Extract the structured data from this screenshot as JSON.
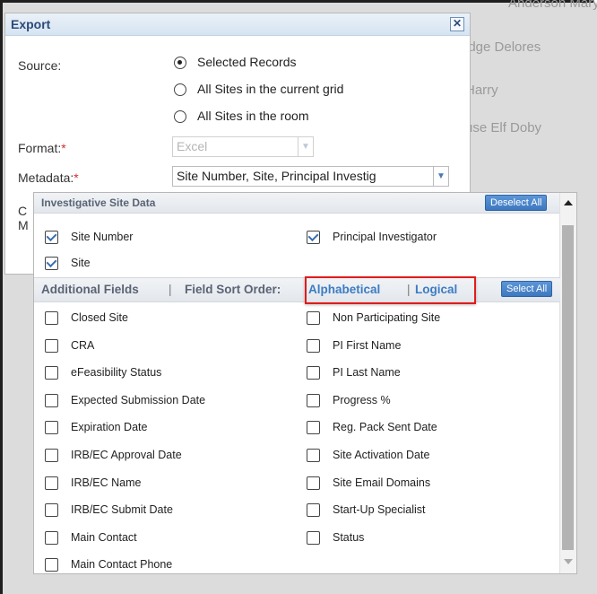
{
  "background_grid": [
    {
      "text": "Anderson Mary"
    },
    {
      "text": "idge Delores"
    },
    {
      "text": "Harry"
    },
    {
      "text": "use Elf Doby"
    }
  ],
  "dialog": {
    "title": "Export",
    "close_label": "✕",
    "source_label": "Source:",
    "source_options": [
      {
        "label": "Selected Records",
        "selected": true
      },
      {
        "label": "All Sites in the current grid",
        "selected": false
      },
      {
        "label": "All Sites in the room",
        "selected": false
      }
    ],
    "format_label": "Format:",
    "format_value": "Excel",
    "metadata_label": "Metadata:",
    "metadata_value": "Site Number, Site, Principal Investig",
    "required_marker": "*",
    "partial_label_1": "C",
    "partial_label_2": "M"
  },
  "field_panel": {
    "section_title": "Investigative Site Data",
    "deselect_all": "Deselect All",
    "select_all": "Select All",
    "selected_fields": [
      {
        "label": "Site Number",
        "checked": true
      },
      {
        "label": "Principal Investigator",
        "checked": true
      },
      {
        "label": "Site",
        "checked": true
      }
    ],
    "additional_fields_label": "Additional Fields",
    "pipe": "|",
    "sort_order_label": "Field Sort Order:",
    "sort_alphabetical": "Alphabetical",
    "sort_logical": "Logical",
    "additional_left": [
      "Closed Site",
      "CRA",
      "eFeasibility Status",
      "Expected Submission Date",
      "Expiration Date",
      "IRB/EC Approval Date",
      "IRB/EC Name",
      "IRB/EC Submit Date",
      "Main Contact",
      "Main Contact Phone"
    ],
    "additional_right": [
      "Non Participating Site",
      "PI First Name",
      "PI Last Name",
      "Progress %",
      "Reg. Pack Sent Date",
      "Site Activation Date",
      "Site Email Domains",
      "Start-Up Specialist",
      "Status"
    ]
  },
  "colors": {
    "accent": "#3c7cc4",
    "highlight": "#e21b1b",
    "required": "#d0312d"
  }
}
